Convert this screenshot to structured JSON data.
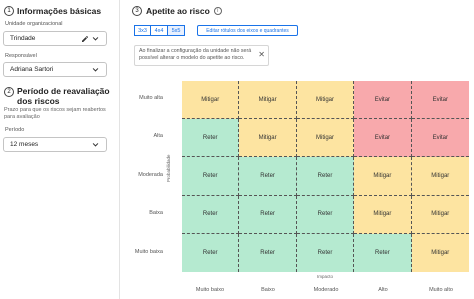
{
  "basic": {
    "number": "1",
    "title": "Informações básicas",
    "unit_label": "Unidade organizacional",
    "unit_value": "Trindade",
    "owner_label": "Responsável",
    "owner_value": "Adriana Sartori"
  },
  "review": {
    "number": "2",
    "title": "Período de reavaliação dos riscos",
    "hint": "Prazo para que os riscos sejam reabertos para avaliação",
    "period_label": "Período",
    "period_value": "12 meses"
  },
  "appetite": {
    "number": "3",
    "title": "Apetite ao risco",
    "sizes": [
      "3x3",
      "4x4",
      "5x5"
    ],
    "active_size": "5x5",
    "edit_button": "Editar rótulos dos eixos e quadrantes",
    "notice": "Ao finalizar a configuração da unidade não será possível alterar o modelo do apetite ao risco.",
    "y_axis_title": "Probabilidade",
    "x_axis_title": "Impacto",
    "y_labels": [
      "Muito alta",
      "Alta",
      "Moderada",
      "Baixa",
      "Muito baixa"
    ],
    "x_labels": [
      "Muito baixo",
      "Baixo",
      "Moderado",
      "Alto",
      "Muito alto"
    ],
    "matrix": [
      [
        "Mitigar",
        "Mitigar",
        "Mitigar",
        "Evitar",
        "Evitar"
      ],
      [
        "Reter",
        "Mitigar",
        "Mitigar",
        "Evitar",
        "Evitar"
      ],
      [
        "Reter",
        "Reter",
        "Reter",
        "Mitigar",
        "Mitigar"
      ],
      [
        "Reter",
        "Reter",
        "Reter",
        "Mitigar",
        "Mitigar"
      ],
      [
        "Reter",
        "Reter",
        "Reter",
        "Reter",
        "Mitigar"
      ]
    ],
    "colors": {
      "Mitigar": "#fde4a1",
      "Evitar": "#f8a9ac",
      "Reter": "#b5ead0"
    }
  }
}
